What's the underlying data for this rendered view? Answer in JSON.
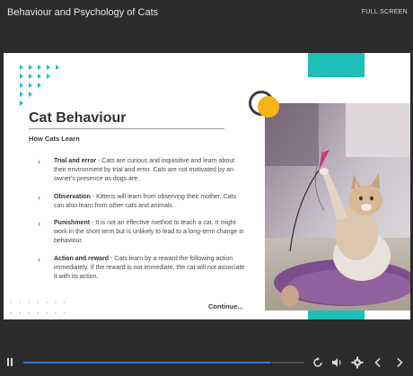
{
  "window": {
    "course_title": "Behaviour and Psychology of Cats",
    "fullscreen_label": "FULL SCREEN"
  },
  "slide": {
    "title": "Cat Behaviour",
    "subtitle": "How Cats Learn",
    "bullets": [
      {
        "term": "Trial and error",
        "text": " - Cats are curious and inquisitive and learn about their environment by trial and error. Cats are not motivated by an owner's presence as dogs are."
      },
      {
        "term": "Observation",
        "text": " - Kittens will learn from observing their mother. Cats can also learn from other cats and animals."
      },
      {
        "term": "Punishment",
        "text": " - It is not an effective method to teach a cat. It might work in the short term but is unlikely to lead to a long-term change in behaviour."
      },
      {
        "term": "Action and reward",
        "text": " - Cats learn by a reward the following action immediately. If the reward is not immediate, the cat will not associate it with its action."
      }
    ],
    "continue_label": "Continue...",
    "accent_teal": "#1dbfb8",
    "accent_yellow": "#f4b41a",
    "bullet_color": "#1a9fd4"
  },
  "player": {
    "progress": 0.88,
    "icons": [
      "pause-icon",
      "replay-icon",
      "volume-icon",
      "settings-icon",
      "prev-icon",
      "next-icon"
    ]
  }
}
